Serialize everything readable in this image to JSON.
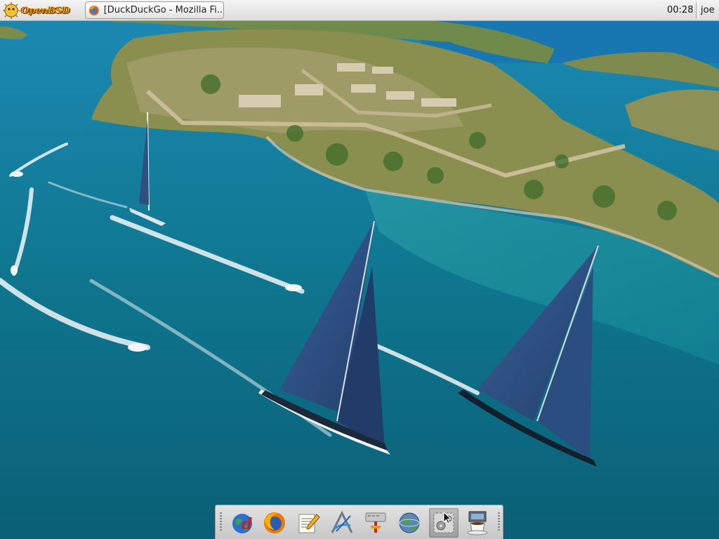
{
  "top_panel": {
    "start_menu_label": "OpenBSD",
    "taskbar_window_title": "[DuckDuckGo - Mozilla Fi...",
    "clock": "00:28",
    "username": "joe"
  },
  "dock": {
    "items": [
      {
        "icon": "web-browser-globe-icon"
      },
      {
        "icon": "firefox-icon"
      },
      {
        "icon": "text-editor-icon"
      },
      {
        "icon": "drawing-app-icon"
      },
      {
        "icon": "system-tool-icon"
      },
      {
        "icon": "network-globe-icon"
      },
      {
        "icon": "settings-icon"
      },
      {
        "icon": "java-coffee-icon"
      }
    ],
    "active_index": 6
  },
  "colors": {
    "panel_bg": "#e6e6e6",
    "sea": "#0c6d86",
    "land": "#7e8e45",
    "sail": "#2c4a7c"
  }
}
